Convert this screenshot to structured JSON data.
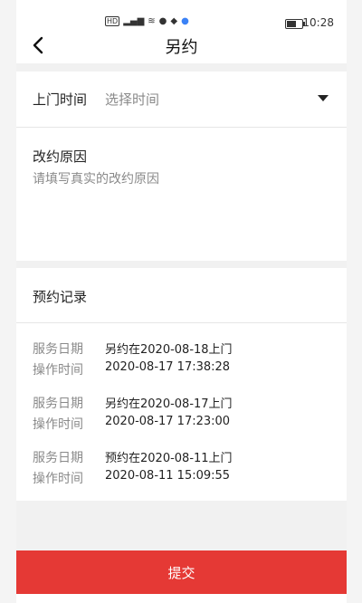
{
  "status_bar": {
    "time": "10:28",
    "network": "HD",
    "battery_level": 0.6
  },
  "header": {
    "title": "另约"
  },
  "form": {
    "visit_time_label": "上门时间",
    "visit_time_value": "选择时间",
    "reason_label": "改约原因",
    "reason_placeholder": "请填写真实的改约原因"
  },
  "records": {
    "title": "预约记录",
    "service_date_label": "服务日期",
    "operation_time_label": "操作时间",
    "items": [
      {
        "service_date": "另约在2020-08-18上门",
        "operation_time": "2020-08-17 17:38:28"
      },
      {
        "service_date": "另约在2020-08-17上门",
        "operation_time": "2020-08-17 17:23:00"
      },
      {
        "service_date": "预约在2020-08-11上门",
        "operation_time": "2020-08-11 15:09:55"
      }
    ]
  },
  "submit": {
    "label": "提交"
  },
  "colors": {
    "accent": "#e53935",
    "page_bg": "#f4f4f4",
    "muted_text": "#8a8a8a"
  },
  "icons": {
    "back": "chevron-left-icon",
    "dropdown": "triangle-down-icon"
  }
}
